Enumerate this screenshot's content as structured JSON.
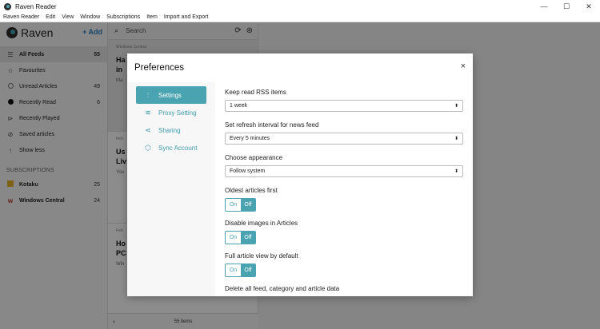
{
  "window": {
    "title": "Raven Reader",
    "minimize": "—",
    "maximize": "☐",
    "close": "✕"
  },
  "menu": [
    "Raven Reader",
    "Edit",
    "View",
    "Window",
    "Subscriptions",
    "Item",
    "Import and Export"
  ],
  "sidebar": {
    "brand": "Raven",
    "add_label": "+ Add",
    "items": [
      {
        "label": "All Feeds",
        "count": "55",
        "icon": "list-icon"
      },
      {
        "label": "Favourites",
        "count": "",
        "icon": "star-icon"
      },
      {
        "label": "Unread Articles",
        "count": "49",
        "icon": "circle-icon"
      },
      {
        "label": "Recently Read",
        "count": "6",
        "icon": "filled-circle-icon"
      },
      {
        "label": "Recently Played",
        "count": "",
        "icon": "play-icon"
      },
      {
        "label": "Saved articles",
        "count": "",
        "icon": "bookmark-icon"
      },
      {
        "label": "Show less",
        "count": "",
        "icon": "arrow-up-icon"
      }
    ],
    "subscriptions_title": "SUBSCRIPTIONS",
    "subscriptions": [
      {
        "label": "Kotaku",
        "count": "25"
      },
      {
        "label": "Windows Central",
        "count": "24"
      }
    ]
  },
  "list": {
    "search_placeholder": "Search",
    "articles": [
      {
        "source": "Windows Central",
        "title": "Ha",
        "title2": "in",
        "body": "Ma"
      },
      {
        "source": "Feb",
        "title": "Us",
        "title2": "Liv",
        "body": "You"
      },
      {
        "source": "Feb",
        "title": "Ho",
        "title2": "PC",
        "body": "Win"
      }
    ],
    "footer": "55 items"
  },
  "modal": {
    "title": "Preferences",
    "close": "×",
    "nav": [
      {
        "label": "Settings",
        "icon": "sliders-icon"
      },
      {
        "label": "Proxy Setting",
        "icon": "wifi-icon"
      },
      {
        "label": "Sharing",
        "icon": "share-icon"
      },
      {
        "label": "Sync Account",
        "icon": "cube-icon"
      }
    ],
    "settings": {
      "keep_read_label": "Keep read RSS items",
      "keep_read_value": "1 week",
      "refresh_label": "Set refresh interval for news feed",
      "refresh_value": "Every 5 minutes",
      "appearance_label": "Choose appearance",
      "appearance_value": "Follow system",
      "oldest_label": "Oldest articles first",
      "disable_images_label": "Disable images in Articles",
      "full_article_label": "Full article view by default",
      "toggle_on": "On",
      "toggle_off": "Off",
      "delete_label": "Delete all feed, category and article data"
    }
  },
  "colors": {
    "accent": "#4aa3b0",
    "link": "#2a7fbf"
  }
}
